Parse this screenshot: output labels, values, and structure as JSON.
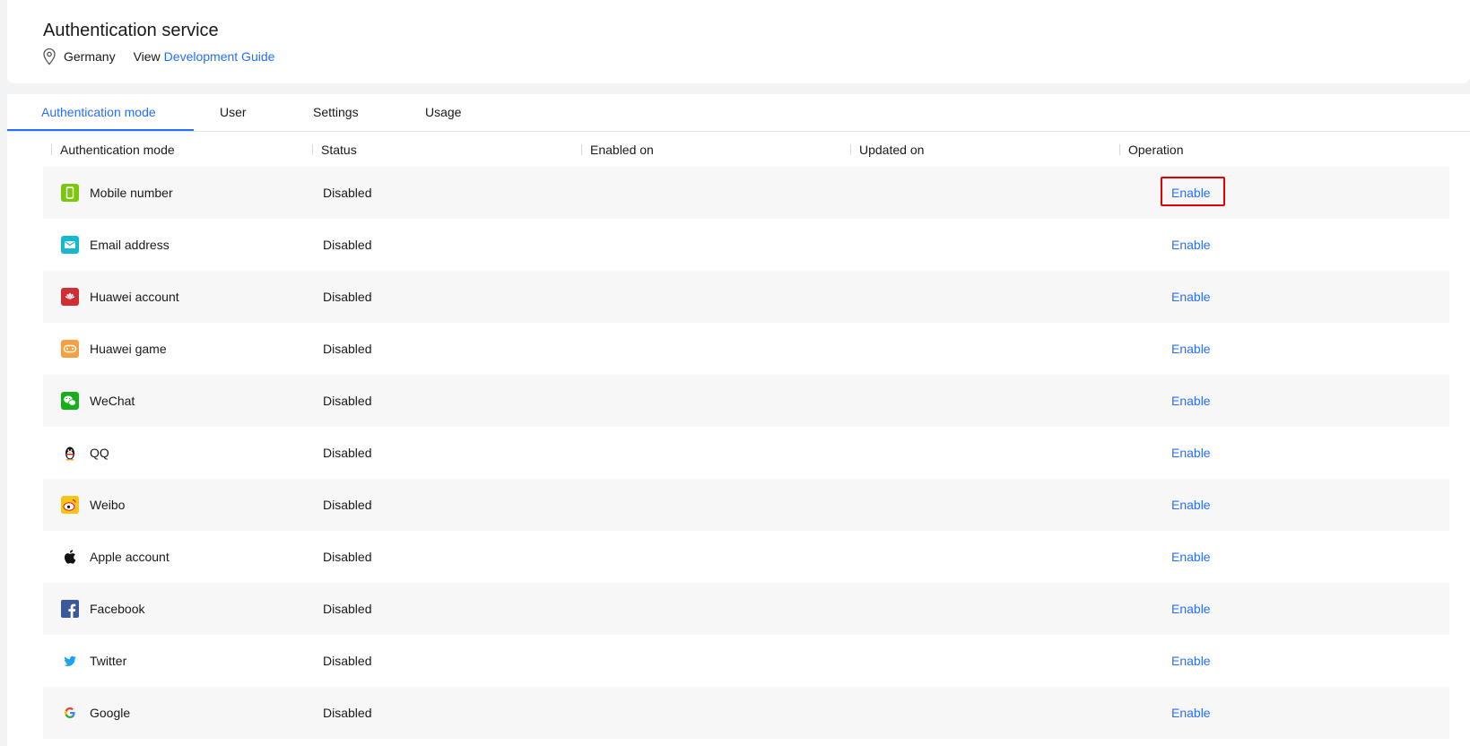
{
  "header": {
    "title": "Authentication service",
    "region": "Germany",
    "view_text": "View",
    "guide_link": "Development Guide"
  },
  "tabs": [
    {
      "label": "Authentication mode",
      "active": true
    },
    {
      "label": "User",
      "active": false
    },
    {
      "label": "Settings",
      "active": false
    },
    {
      "label": "Usage",
      "active": false
    }
  ],
  "table": {
    "columns": [
      "Authentication mode",
      "Status",
      "Enabled on",
      "Updated on",
      "Operation"
    ],
    "rows": [
      {
        "mode": "Mobile number",
        "icon": "mobile-icon",
        "status": "Disabled",
        "enabled_on": "",
        "updated_on": "",
        "operation": "Enable",
        "highlighted": true
      },
      {
        "mode": "Email address",
        "icon": "email-icon",
        "status": "Disabled",
        "enabled_on": "",
        "updated_on": "",
        "operation": "Enable"
      },
      {
        "mode": "Huawei account",
        "icon": "huawei-icon",
        "status": "Disabled",
        "enabled_on": "",
        "updated_on": "",
        "operation": "Enable"
      },
      {
        "mode": "Huawei game",
        "icon": "gamepad-icon",
        "status": "Disabled",
        "enabled_on": "",
        "updated_on": "",
        "operation": "Enable"
      },
      {
        "mode": "WeChat",
        "icon": "wechat-icon",
        "status": "Disabled",
        "enabled_on": "",
        "updated_on": "",
        "operation": "Enable"
      },
      {
        "mode": "QQ",
        "icon": "qq-penguin-icon",
        "status": "Disabled",
        "enabled_on": "",
        "updated_on": "",
        "operation": "Enable"
      },
      {
        "mode": "Weibo",
        "icon": "weibo-icon",
        "status": "Disabled",
        "enabled_on": "",
        "updated_on": "",
        "operation": "Enable"
      },
      {
        "mode": "Apple account",
        "icon": "apple-icon",
        "status": "Disabled",
        "enabled_on": "",
        "updated_on": "",
        "operation": "Enable"
      },
      {
        "mode": "Facebook",
        "icon": "facebook-icon",
        "status": "Disabled",
        "enabled_on": "",
        "updated_on": "",
        "operation": "Enable"
      },
      {
        "mode": "Twitter",
        "icon": "twitter-icon",
        "status": "Disabled",
        "enabled_on": "",
        "updated_on": "",
        "operation": "Enable"
      },
      {
        "mode": "Google",
        "icon": "google-icon",
        "status": "Disabled",
        "enabled_on": "",
        "updated_on": "",
        "operation": "Enable"
      }
    ]
  },
  "colors": {
    "accent": "#256fff",
    "highlight": "#e30000"
  }
}
